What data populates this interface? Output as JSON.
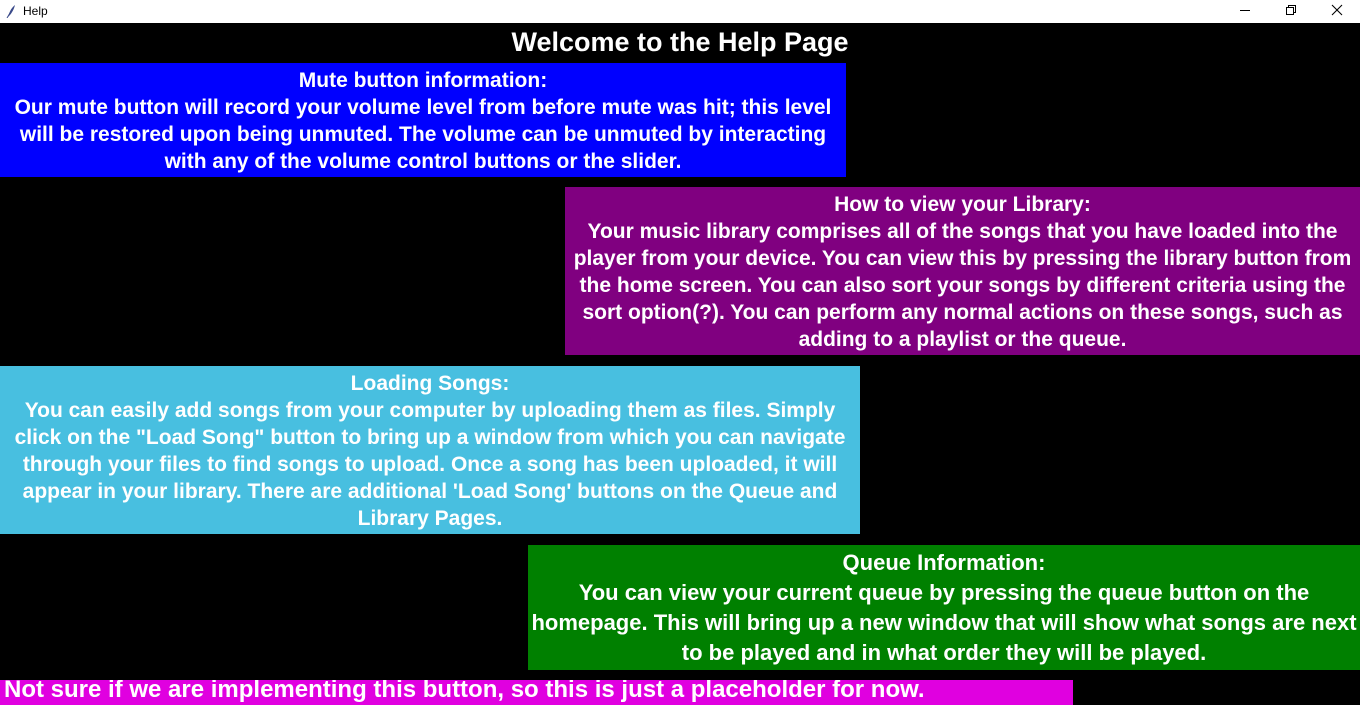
{
  "window": {
    "title": "Help",
    "icon": "feather-icon",
    "controls": [
      "minimize-icon",
      "restore-icon",
      "close-icon"
    ]
  },
  "page": {
    "heading": "Welcome to the Help Page"
  },
  "sections": {
    "mute": {
      "title": "Mute button information:",
      "body": "Our mute button will record your volume level from before mute was hit; this level will be restored upon being unmuted. The volume can be unmuted by interacting with any of the volume control buttons or the slider.",
      "color": "#0000ff"
    },
    "library": {
      "title": "How to view your Library:",
      "body": "Your music library comprises all of the songs that you have loaded into the player from your device. You can view this by pressing the library button from the home screen. You can also sort your songs by different criteria using the sort option(?). You can perform any normal actions on these songs, such as adding to a playlist or the queue.",
      "color": "#800080"
    },
    "loading": {
      "title": "Loading Songs:",
      "body": "You can easily add songs from your computer by uploading them as files. Simply click on the \"Load Song\" button to bring up a window from which you can navigate through your files to find songs to upload. Once a song has been uploaded, it will appear in your library. There are additional 'Load Song' buttons on the Queue and Library Pages.",
      "color": "#48bfe0"
    },
    "queue": {
      "title": "Queue Information:",
      "body": "You can view your current queue by pressing the queue button on the homepage. This will bring up a new window that will show what songs are next to be played and in what order they will be played.",
      "color": "#008000"
    },
    "placeholder": {
      "body": "Not sure if we are implementing this button, so this is just a placeholder for now.",
      "color": "#e000e0"
    }
  }
}
